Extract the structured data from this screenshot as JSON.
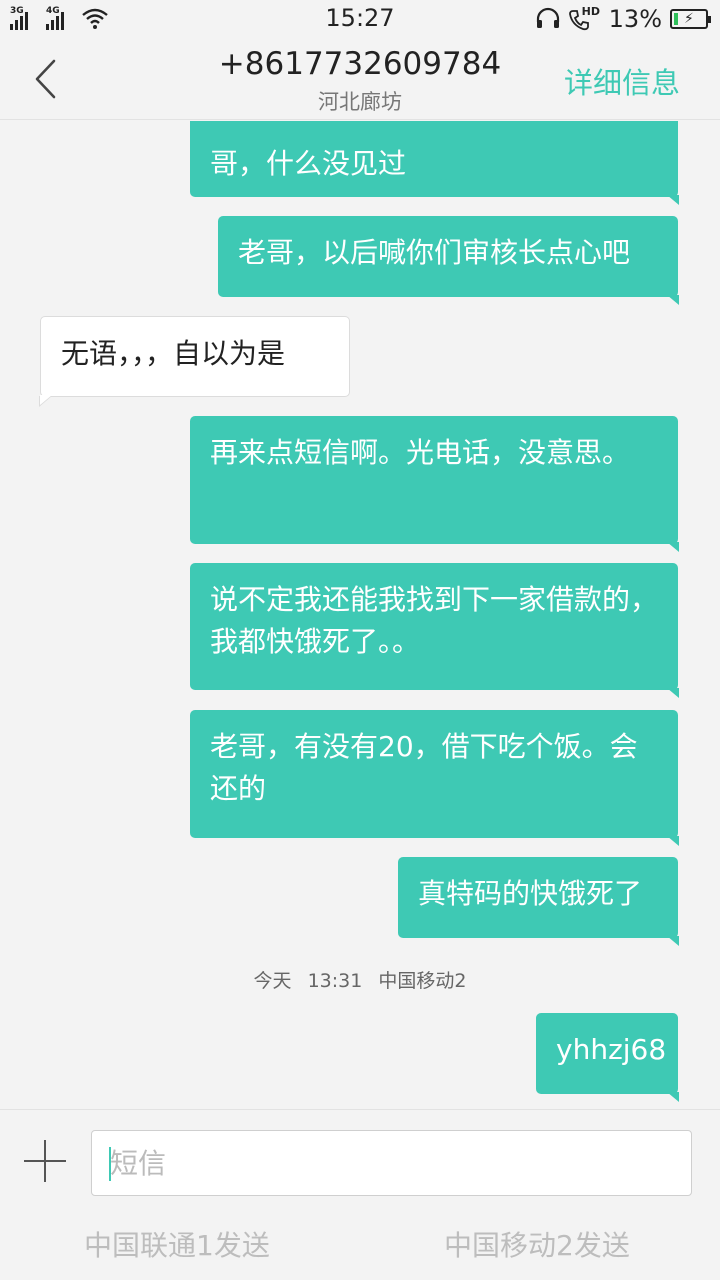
{
  "status_bar": {
    "sim1_network": "3G",
    "sim2_network": "4G",
    "time": "15:27",
    "hd_label": "HD",
    "battery_percent": "13%",
    "battery_level": 0.13,
    "battery_color": "#2fbf5a"
  },
  "header": {
    "phone_number": "+8617732609784",
    "location": "河北廊坊",
    "details_label": "详细信息"
  },
  "colors": {
    "accent": "#3ec9b4"
  },
  "messages": [
    {
      "direction": "out",
      "text": "哥，什么没见过"
    },
    {
      "direction": "out",
      "text": "老哥，以后喊你们审核长点心吧"
    },
    {
      "direction": "in",
      "text": "无语，，，自以为是"
    },
    {
      "direction": "out",
      "text": "再来点短信啊。光电话，没意思。"
    },
    {
      "direction": "out",
      "text": "说不定我还能我找到下一家借款的，我都快饿死了。。"
    },
    {
      "direction": "out",
      "text": "老哥，有没有20，借下吃个饭。会还的"
    },
    {
      "direction": "out",
      "text": "真特码的快饿死了"
    },
    {
      "direction": "out",
      "text": "yhhzj68"
    }
  ],
  "timestamp": {
    "day": "今天",
    "time": "13:31",
    "carrier": "中国移动2"
  },
  "composer": {
    "placeholder": "短信",
    "send_sim1_label": "中国联通1发送",
    "send_sim2_label": "中国移动2发送"
  }
}
